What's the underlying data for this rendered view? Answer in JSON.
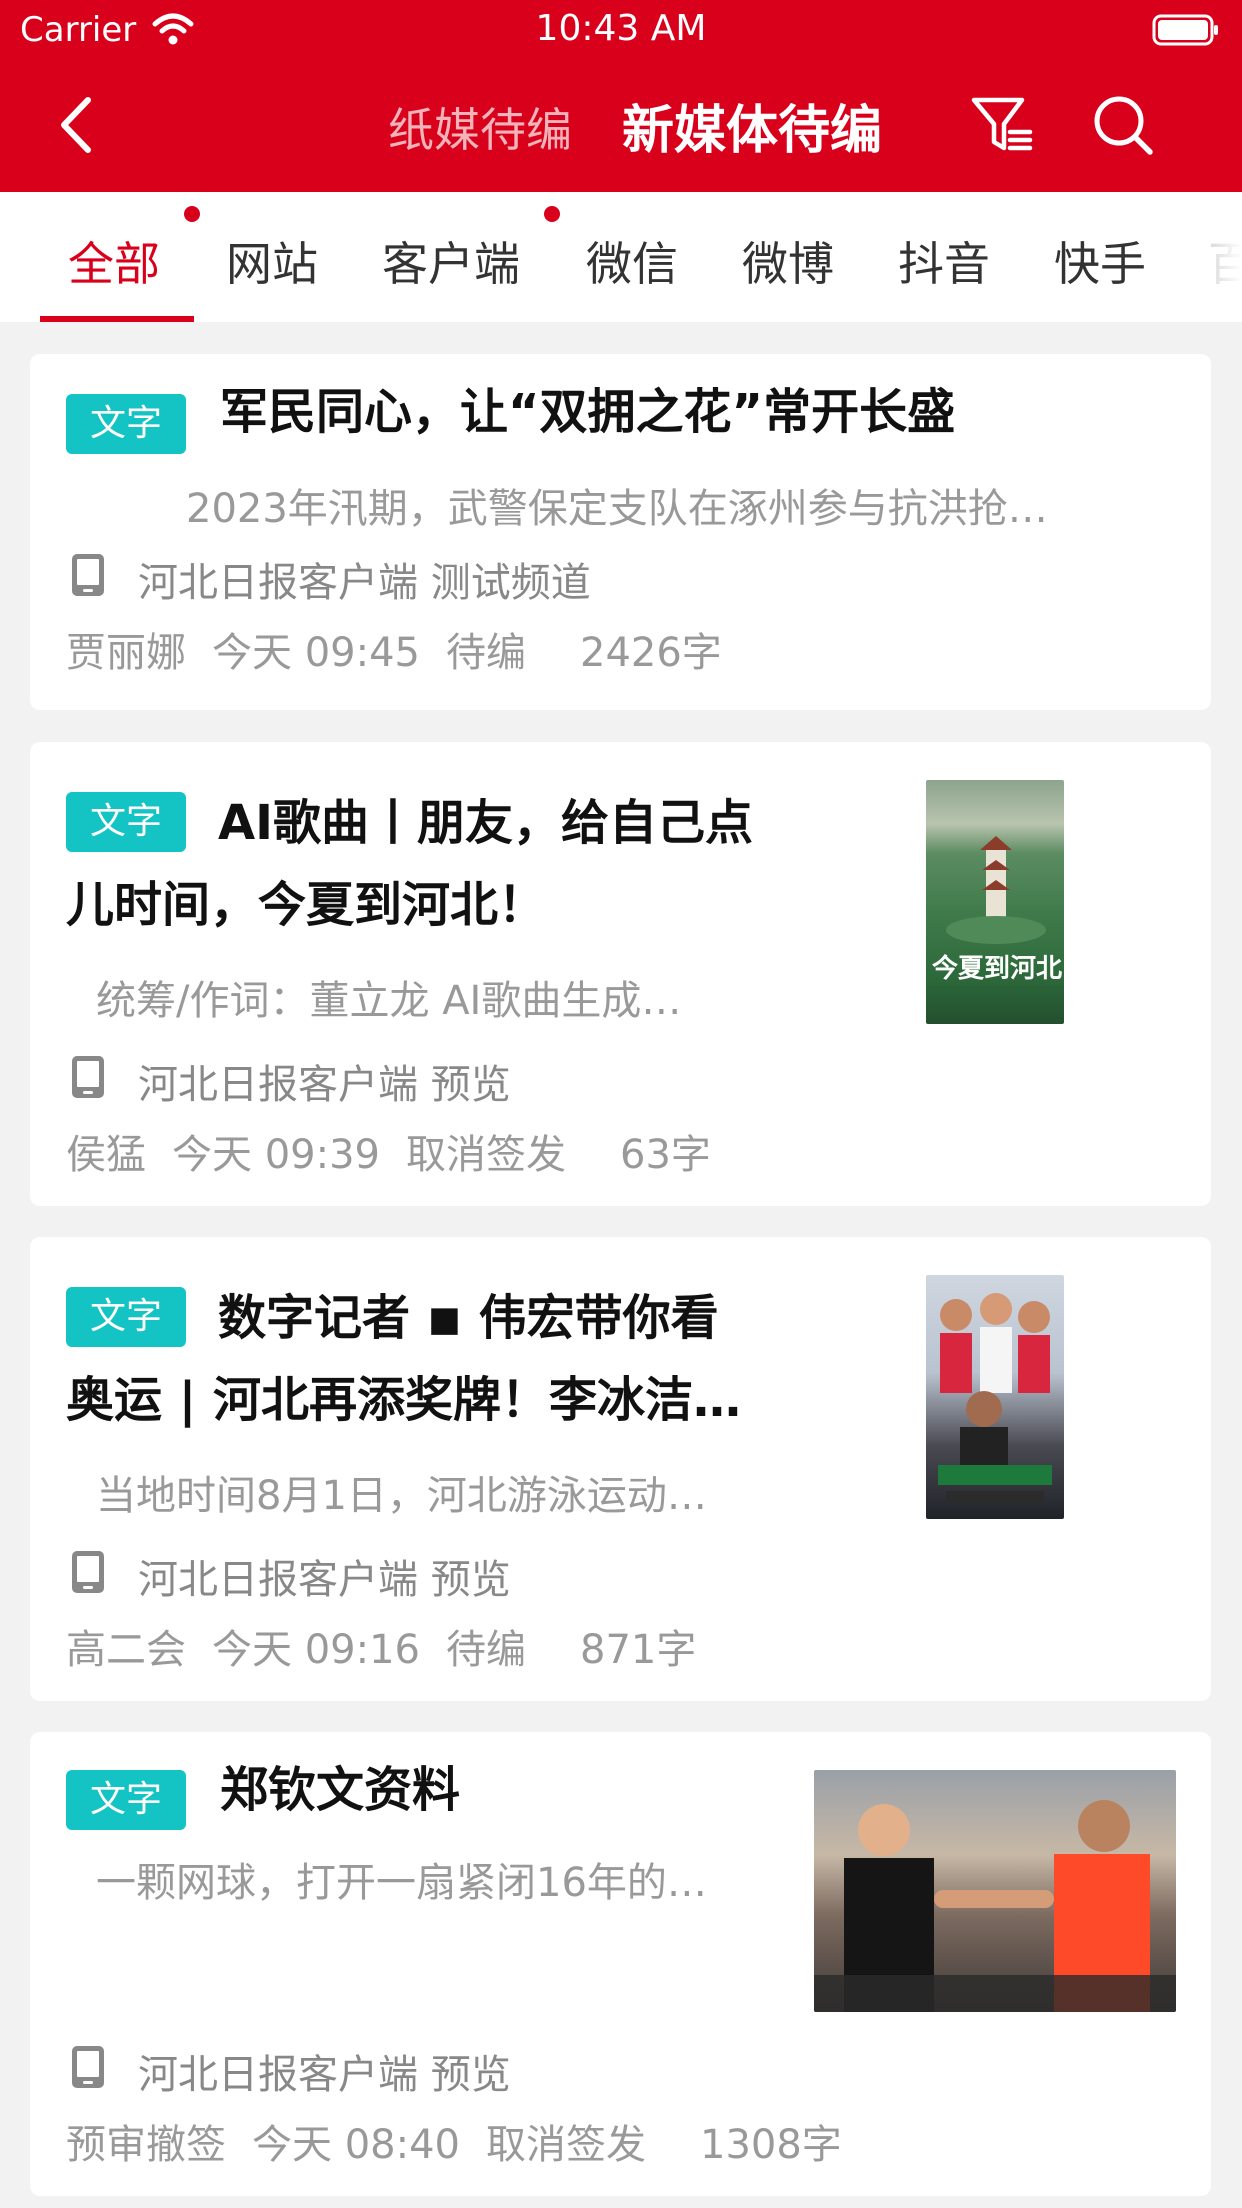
{
  "status_bar": {
    "carrier": "Carrier",
    "time": "10:43 AM"
  },
  "nav": {
    "tab_paper": "纸媒待编",
    "tab_new_media": "新媒体待编"
  },
  "tabs": [
    "全部",
    "网站",
    "客户端",
    "微信",
    "微博",
    "抖音",
    "快手",
    "百"
  ],
  "colors": {
    "brand_red": "#d9001b",
    "badge_teal": "#14c3c3"
  },
  "articles": [
    {
      "badge": "文字",
      "title": "军民同心，让“双拥之花”常开长盛",
      "summary": "2023年汛期，武警保定支队在涿州参与抗洪抢…",
      "channel": "河北日报客户端 测试频道",
      "author": "贾丽娜",
      "time": "今天 09:45",
      "status": "待编",
      "word_count": "2426字"
    },
    {
      "badge": "文字",
      "title_line1": "AI歌曲丨朋友，给自己点",
      "title_line2": "儿时间，今夏到河北！",
      "summary": "统筹/作词：董立龙 AI歌曲生成…",
      "channel": "河北日报客户端 预览",
      "author": "侯猛",
      "time": "今天 09:39",
      "status": "取消签发",
      "word_count": "63字",
      "thumb_text": "今夏到河北"
    },
    {
      "badge": "文字",
      "title_line1": "数字记者 ◾ 伟宏带你看",
      "title_line2": "奥运 | 河北再添奖牌！李冰洁…",
      "summary": "当地时间8月1日，河北游泳运动…",
      "channel": "河北日报客户端 预览",
      "author": "高二会",
      "time": "今天 09:16",
      "status": "待编",
      "word_count": "871字"
    },
    {
      "badge": "文字",
      "title": "郑钦文资料",
      "summary": "一颗网球，打开一扇紧闭16年的…",
      "channel": "河北日报客户端 预览",
      "author": "预审撤签",
      "time": "今天 08:40",
      "status": "取消签发",
      "word_count": "1308字"
    }
  ]
}
